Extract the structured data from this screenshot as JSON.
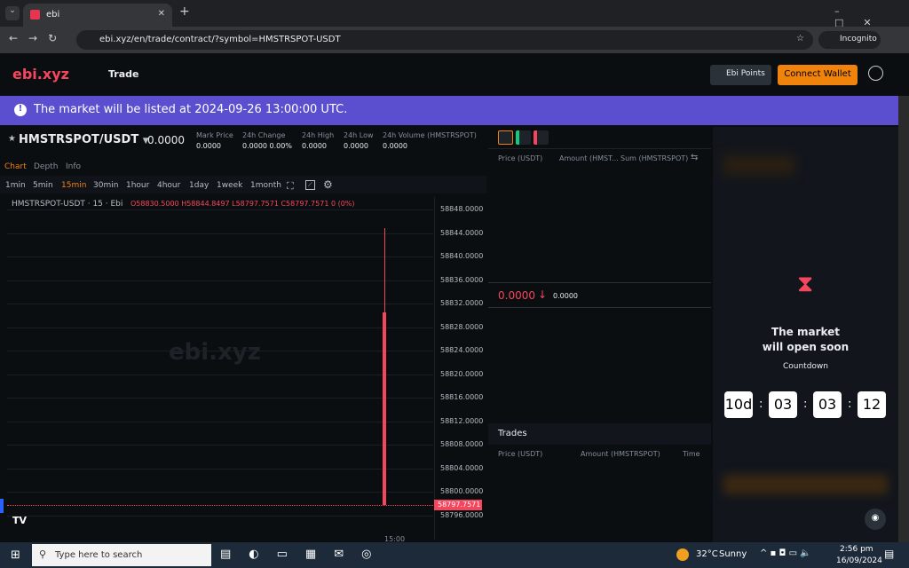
{
  "browser": {
    "tab_title": "ebi",
    "url": "ebi.xyz/en/trade/contract/?symbol=HMSTRSPOT-USDT",
    "incognito": "Incognito"
  },
  "nav": {
    "logo": "ebi.xyz",
    "trade": "Trade",
    "points": "Ebi Points",
    "connect": "Connect Wallet"
  },
  "banner": {
    "text": "The market will be listed at 2024-09-26 13:00:00 UTC."
  },
  "ticker": {
    "symbol": "HMSTRSPOT/USDT",
    "price": "0.0000",
    "stats": [
      {
        "label": "Mark Price",
        "value": "0.0000"
      },
      {
        "label": "24h Change",
        "value": "0.0000  0.00%"
      },
      {
        "label": "24h High",
        "value": "0.0000"
      },
      {
        "label": "24h Low",
        "value": "0.0000"
      },
      {
        "label": "24h Volume (HMSTRSPOT)",
        "value": "0.0000"
      }
    ]
  },
  "chart_tabs": [
    "Chart",
    "Depth",
    "Info"
  ],
  "timeframes": [
    "1min",
    "5min",
    "15min",
    "30min",
    "1hour",
    "4hour",
    "1day",
    "1week",
    "1month"
  ],
  "active_timeframe": "15min",
  "legend": {
    "title": "HMSTRSPOT-USDT · 15 · Ebi",
    "o": "O58830.5000",
    "h": "H58844.8497",
    "l": "L58797.7571",
    "c": "C58797.7571",
    "chg": "0 (0%)"
  },
  "watermark": "ebi.xyz",
  "chart_data": {
    "type": "candlestick",
    "x": [
      "15:00"
    ],
    "open": 58830.5,
    "high": 58844.8497,
    "low": 58797.7571,
    "close": 58797.7571,
    "yticks": [
      "58848.0000",
      "58844.0000",
      "58840.0000",
      "58836.0000",
      "58832.0000",
      "58828.0000",
      "58824.0000",
      "58820.0000",
      "58816.0000",
      "58812.0000",
      "58808.0000",
      "58804.0000",
      "58800.0000",
      "58796.0000"
    ],
    "last_price_label": "58797.7571",
    "ylim": [
      58796,
      58848
    ],
    "xtick": "15:00",
    "color_down": "#f6465d"
  },
  "orderbook": {
    "cols": [
      "Price (USDT)",
      "Amount (HMST...",
      "Sum (HMSTRSPOT)"
    ],
    "mid_price": "0.0000",
    "mid_sub": "0.0000"
  },
  "trades": {
    "title": "Trades",
    "cols": [
      "Price (USDT)",
      "Amount (HMSTRSPOT)",
      "Time"
    ]
  },
  "right": {
    "title1": "The market",
    "title2": "will open soon",
    "countdown_label": "Countdown",
    "days": "10d",
    "hours": "03",
    "minutes": "03",
    "seconds": "12"
  },
  "taskbar": {
    "search": "Type here to search",
    "temp": "32°C",
    "weather": "Sunny",
    "time": "2:56 pm",
    "date": "16/09/2024"
  },
  "colors": {
    "accent": "#f0830c",
    "banner": "#5b4fcf",
    "down": "#f6465d",
    "up": "#0ecb81"
  }
}
